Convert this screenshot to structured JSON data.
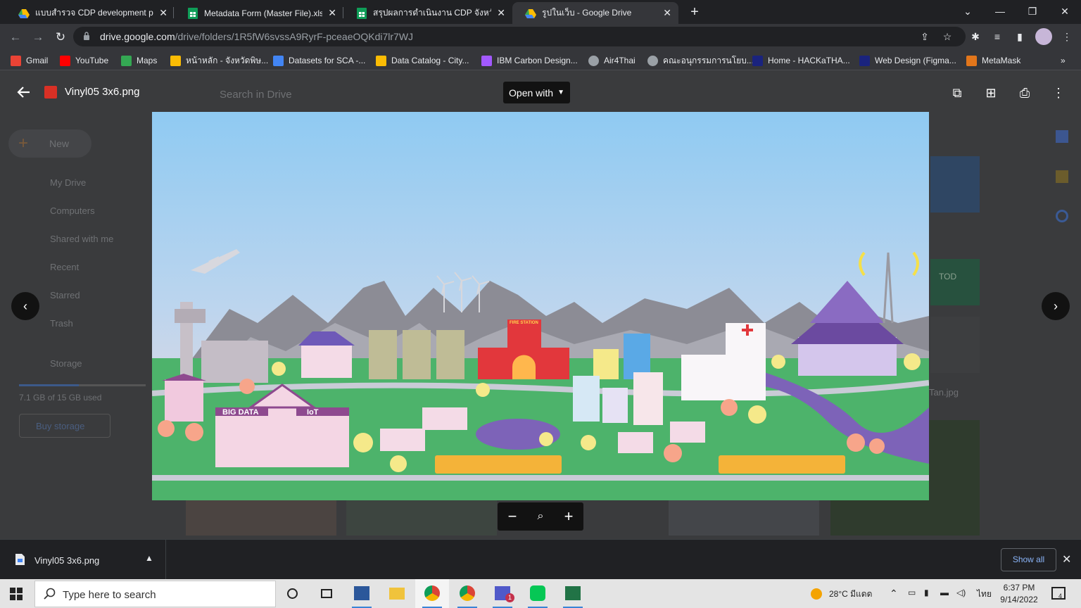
{
  "browser": {
    "tabs": [
      {
        "title": "แบบสำรวจ CDP development prog",
        "icon": "google-drive-icon",
        "active": false
      },
      {
        "title": "Metadata Form (Master File).xlsx",
        "icon": "google-sheets-icon",
        "active": false
      },
      {
        "title": "สรุปผลการดำเนินงาน CDP จังหวัดพิษ",
        "icon": "google-sheets-icon",
        "active": false
      },
      {
        "title": "รูปในเว็บ - Google Drive",
        "icon": "google-drive-icon",
        "active": true
      }
    ],
    "url_domain": "drive.google.com",
    "url_path": "/drive/folders/1R5fW6svssA9RyrF-pceaeOQKdi7lr7WJ",
    "bookmarks": [
      {
        "label": "Gmail",
        "icon": "gmail-icon",
        "color": "#ea4335"
      },
      {
        "label": "YouTube",
        "icon": "youtube-icon",
        "color": "#ff0000"
      },
      {
        "label": "Maps",
        "icon": "maps-icon",
        "color": "#34a853"
      },
      {
        "label": "หน้าหลัก - จังหวัดพิษ...",
        "icon": "site-icon",
        "color": "#fbbc04"
      },
      {
        "label": "Datasets for SCA -...",
        "icon": "google-drive-icon",
        "color": "#4285f4"
      },
      {
        "label": "Data Catalog - City...",
        "icon": "site-icon",
        "color": "#fbbc04"
      },
      {
        "label": "IBM Carbon Design...",
        "icon": "figma-icon",
        "color": "#a259ff"
      },
      {
        "label": "Air4Thai",
        "icon": "globe-icon",
        "color": "#9aa0a6"
      },
      {
        "label": "คณะอนุกรรมการนโยบ...",
        "icon": "globe-icon",
        "color": "#9aa0a6"
      },
      {
        "label": "Home - HACKaTHA...",
        "icon": "site-icon",
        "color": "#1a237e"
      },
      {
        "label": "Web Design (Figma...",
        "icon": "site-icon",
        "color": "#1a237e"
      },
      {
        "label": "MetaMask",
        "icon": "metamask-icon",
        "color": "#e2761b"
      }
    ]
  },
  "drive_bg": {
    "search_placeholder": "Search in Drive",
    "new_label": "New",
    "nav": [
      "My Drive",
      "Computers",
      "Shared with me",
      "Recent",
      "Starred",
      "Trash",
      "Storage"
    ],
    "storage_text": "7.1 GB of 15 GB used",
    "buy_storage": "Buy storage",
    "partial_thumb_label": "TOD",
    "partial_file_name": "Tan.jpg"
  },
  "viewer": {
    "file_name": "Vinyl05 3x6.png",
    "open_with": "Open with"
  },
  "image_text": {
    "fire_station": "FIRE STATION",
    "big_data": "BIG DATA",
    "iot": "IoT"
  },
  "download": {
    "file_name": "Vinyl05 3x6.png",
    "show_all": "Show all"
  },
  "taskbar": {
    "search_placeholder": "Type here to search",
    "weather": "28°C มีแดด",
    "lang": "ไทย",
    "time": "6:37 PM",
    "date": "9/14/2022",
    "notif_count": "4",
    "teams_badge": "1"
  }
}
